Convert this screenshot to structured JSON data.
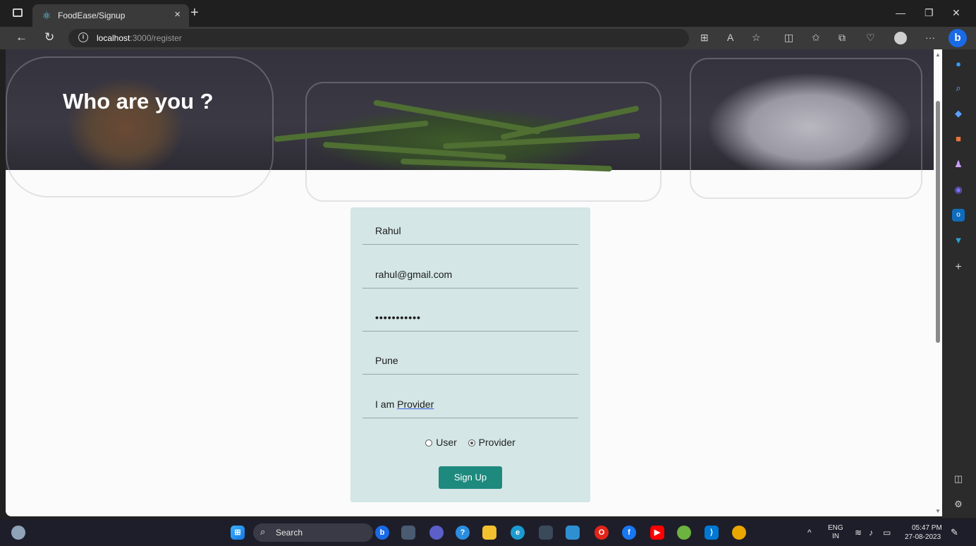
{
  "browser": {
    "tab_title": "FoodEase/Signup",
    "tab_close": "×",
    "new_tab": "+",
    "url_host": "localhost",
    "url_path": ":3000/register"
  },
  "page": {
    "hero_title": "Who are you ?",
    "form": {
      "name_value": "Rahul",
      "email_value": "rahul@gmail.com",
      "password_value": "•••••••••••",
      "city_value": "Pune",
      "role_prefix": "I am ",
      "role_value": "Provider",
      "radio_user_label": "User",
      "radio_provider_label": "Provider",
      "selected_role": "Provider",
      "submit_label": "Sign Up"
    }
  },
  "taskbar": {
    "search_label": "Search",
    "lang_top": "ENG",
    "lang_bottom": "IN",
    "time": "05:47 PM",
    "date": "27-08-2023"
  },
  "colors": {
    "card_bg": "#d4e6e6",
    "button_bg": "#1e8a7e",
    "accent": "#1a6ae6"
  }
}
